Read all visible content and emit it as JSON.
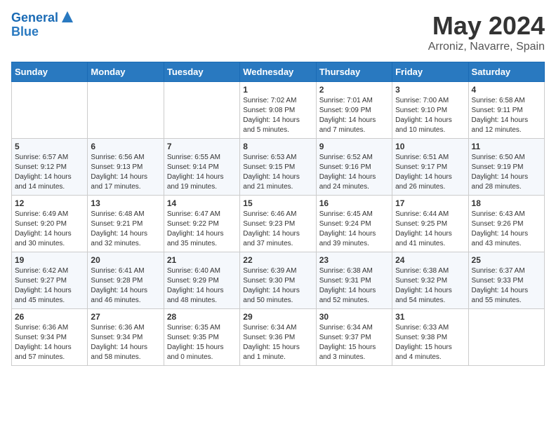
{
  "logo": {
    "line1": "General",
    "line2": "Blue"
  },
  "title": "May 2024",
  "subtitle": "Arroniz, Navarre, Spain",
  "days_of_week": [
    "Sunday",
    "Monday",
    "Tuesday",
    "Wednesday",
    "Thursday",
    "Friday",
    "Saturday"
  ],
  "weeks": [
    [
      {
        "day": "",
        "content": ""
      },
      {
        "day": "",
        "content": ""
      },
      {
        "day": "",
        "content": ""
      },
      {
        "day": "1",
        "content": "Sunrise: 7:02 AM\nSunset: 9:08 PM\nDaylight: 14 hours\nand 5 minutes."
      },
      {
        "day": "2",
        "content": "Sunrise: 7:01 AM\nSunset: 9:09 PM\nDaylight: 14 hours\nand 7 minutes."
      },
      {
        "day": "3",
        "content": "Sunrise: 7:00 AM\nSunset: 9:10 PM\nDaylight: 14 hours\nand 10 minutes."
      },
      {
        "day": "4",
        "content": "Sunrise: 6:58 AM\nSunset: 9:11 PM\nDaylight: 14 hours\nand 12 minutes."
      }
    ],
    [
      {
        "day": "5",
        "content": "Sunrise: 6:57 AM\nSunset: 9:12 PM\nDaylight: 14 hours\nand 14 minutes."
      },
      {
        "day": "6",
        "content": "Sunrise: 6:56 AM\nSunset: 9:13 PM\nDaylight: 14 hours\nand 17 minutes."
      },
      {
        "day": "7",
        "content": "Sunrise: 6:55 AM\nSunset: 9:14 PM\nDaylight: 14 hours\nand 19 minutes."
      },
      {
        "day": "8",
        "content": "Sunrise: 6:53 AM\nSunset: 9:15 PM\nDaylight: 14 hours\nand 21 minutes."
      },
      {
        "day": "9",
        "content": "Sunrise: 6:52 AM\nSunset: 9:16 PM\nDaylight: 14 hours\nand 24 minutes."
      },
      {
        "day": "10",
        "content": "Sunrise: 6:51 AM\nSunset: 9:17 PM\nDaylight: 14 hours\nand 26 minutes."
      },
      {
        "day": "11",
        "content": "Sunrise: 6:50 AM\nSunset: 9:19 PM\nDaylight: 14 hours\nand 28 minutes."
      }
    ],
    [
      {
        "day": "12",
        "content": "Sunrise: 6:49 AM\nSunset: 9:20 PM\nDaylight: 14 hours\nand 30 minutes."
      },
      {
        "day": "13",
        "content": "Sunrise: 6:48 AM\nSunset: 9:21 PM\nDaylight: 14 hours\nand 32 minutes."
      },
      {
        "day": "14",
        "content": "Sunrise: 6:47 AM\nSunset: 9:22 PM\nDaylight: 14 hours\nand 35 minutes."
      },
      {
        "day": "15",
        "content": "Sunrise: 6:46 AM\nSunset: 9:23 PM\nDaylight: 14 hours\nand 37 minutes."
      },
      {
        "day": "16",
        "content": "Sunrise: 6:45 AM\nSunset: 9:24 PM\nDaylight: 14 hours\nand 39 minutes."
      },
      {
        "day": "17",
        "content": "Sunrise: 6:44 AM\nSunset: 9:25 PM\nDaylight: 14 hours\nand 41 minutes."
      },
      {
        "day": "18",
        "content": "Sunrise: 6:43 AM\nSunset: 9:26 PM\nDaylight: 14 hours\nand 43 minutes."
      }
    ],
    [
      {
        "day": "19",
        "content": "Sunrise: 6:42 AM\nSunset: 9:27 PM\nDaylight: 14 hours\nand 45 minutes."
      },
      {
        "day": "20",
        "content": "Sunrise: 6:41 AM\nSunset: 9:28 PM\nDaylight: 14 hours\nand 46 minutes."
      },
      {
        "day": "21",
        "content": "Sunrise: 6:40 AM\nSunset: 9:29 PM\nDaylight: 14 hours\nand 48 minutes."
      },
      {
        "day": "22",
        "content": "Sunrise: 6:39 AM\nSunset: 9:30 PM\nDaylight: 14 hours\nand 50 minutes."
      },
      {
        "day": "23",
        "content": "Sunrise: 6:38 AM\nSunset: 9:31 PM\nDaylight: 14 hours\nand 52 minutes."
      },
      {
        "day": "24",
        "content": "Sunrise: 6:38 AM\nSunset: 9:32 PM\nDaylight: 14 hours\nand 54 minutes."
      },
      {
        "day": "25",
        "content": "Sunrise: 6:37 AM\nSunset: 9:33 PM\nDaylight: 14 hours\nand 55 minutes."
      }
    ],
    [
      {
        "day": "26",
        "content": "Sunrise: 6:36 AM\nSunset: 9:34 PM\nDaylight: 14 hours\nand 57 minutes."
      },
      {
        "day": "27",
        "content": "Sunrise: 6:36 AM\nSunset: 9:34 PM\nDaylight: 14 hours\nand 58 minutes."
      },
      {
        "day": "28",
        "content": "Sunrise: 6:35 AM\nSunset: 9:35 PM\nDaylight: 15 hours\nand 0 minutes."
      },
      {
        "day": "29",
        "content": "Sunrise: 6:34 AM\nSunset: 9:36 PM\nDaylight: 15 hours\nand 1 minute."
      },
      {
        "day": "30",
        "content": "Sunrise: 6:34 AM\nSunset: 9:37 PM\nDaylight: 15 hours\nand 3 minutes."
      },
      {
        "day": "31",
        "content": "Sunrise: 6:33 AM\nSunset: 9:38 PM\nDaylight: 15 hours\nand 4 minutes."
      },
      {
        "day": "",
        "content": ""
      }
    ]
  ]
}
